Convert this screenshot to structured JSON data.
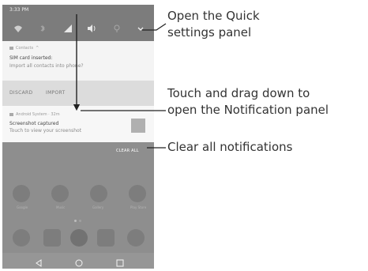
{
  "status_bar": {
    "time": "3:33 PM"
  },
  "quick_settings_icons": [
    "wifi-icon",
    "bluetooth-icon",
    "signal-icon",
    "volume-icon",
    "location-icon",
    "expand-chevron-icon"
  ],
  "notifications": [
    {
      "app": "Contacts",
      "title": "SIM card inserted:",
      "body": "Import all contacts into phone?",
      "actions": [
        "DISCARD",
        "IMPORT"
      ]
    },
    {
      "app": "Android System · 32m",
      "title": "Screenshot captured",
      "body": "Touch to view your screenshot"
    }
  ],
  "clear_all_label": "CLEAR ALL",
  "home_screen": {
    "app_labels": [
      "Google",
      "Music",
      "Gallery",
      "Play Store"
    ]
  },
  "nav_buttons": [
    "back-icon",
    "home-icon",
    "recents-icon"
  ],
  "callouts": {
    "quick_settings": [
      "Open the Quick",
      "settings panel"
    ],
    "notification_panel": [
      "Touch and drag down to",
      "open the Notification panel"
    ],
    "clear_all": "Clear all notifications"
  },
  "colors": {
    "status_bar_bg": "#7c7c7c",
    "card_bg": "#f4f4f4",
    "action_bar_bg": "#dcdcdc",
    "home_bg": "#8e8e8e"
  }
}
